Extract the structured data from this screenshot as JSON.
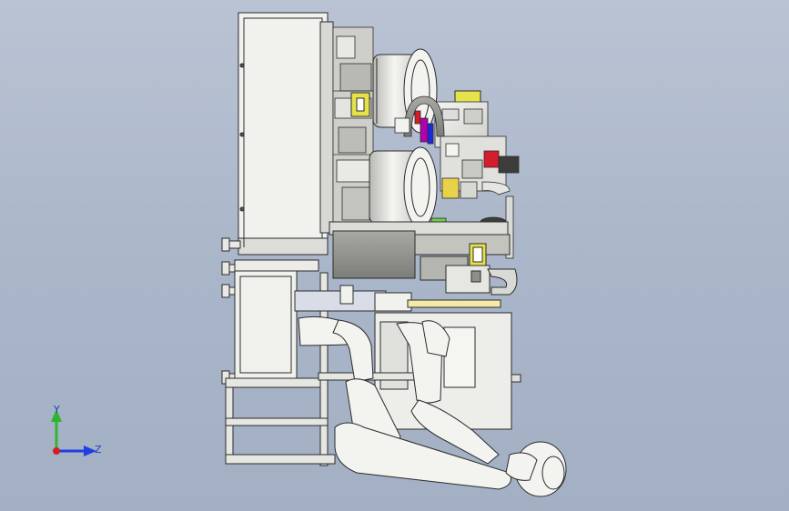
{
  "viewport": {
    "background_top": "#b9c3d4",
    "background_bottom": "#a3afc3"
  },
  "triad": {
    "y_label": "Y",
    "z_label": "Z",
    "y_color": "#2fb52f",
    "z_color": "#1f3fe0",
    "x_color": "#d01f1f"
  },
  "colors": {
    "part_fill": "#ecebe7",
    "part_dark": "#8f8f8a",
    "line": "#2b2b2b",
    "accent_yellow": "#e6e24a",
    "accent_magenta": "#b000b0",
    "accent_red": "#d41c2a",
    "accent_blue": "#1a2ad6",
    "accent_green": "#6ccf4a"
  }
}
